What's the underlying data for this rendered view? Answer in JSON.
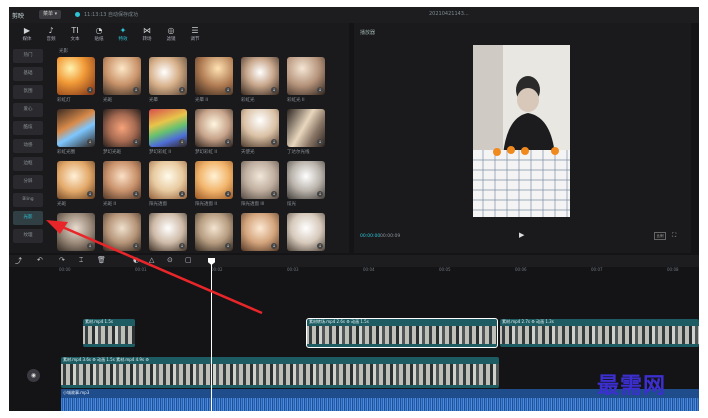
{
  "titlebar": {
    "app_name": "剪映",
    "menu": "菜单 ▾",
    "status": "11:13:13 自动保存成功",
    "project": "20210421143..."
  },
  "tabs": [
    {
      "icon": "▶",
      "label": "媒体"
    },
    {
      "icon": "♪",
      "label": "音频"
    },
    {
      "icon": "TI",
      "label": "文本"
    },
    {
      "icon": "◔",
      "label": "贴纸"
    },
    {
      "icon": "✦",
      "label": "特效"
    },
    {
      "icon": "⋈",
      "label": "转场"
    },
    {
      "icon": "◎",
      "label": "滤镜"
    },
    {
      "icon": "☰",
      "label": "调节"
    }
  ],
  "categories": [
    "热门",
    "基础",
    "氛围",
    "爱心",
    "酷炫",
    "动感",
    "边框",
    "分屏",
    "Bling",
    "光影",
    "纹理"
  ],
  "active_category": "光影",
  "grid_heading": "光影",
  "effects": [
    {
      "label": "彩虹灯",
      "g": "radial-gradient(circle at 35% 30%,#fff3b0,#f29b38 40%,#8a3d1a 90%)"
    },
    {
      "label": "光斑",
      "g": "radial-gradient(circle at 50% 30%,#fde7c7,#c9936a 50%,#4a3a2e 95%)"
    },
    {
      "label": "光晕",
      "g": "radial-gradient(circle at 40% 40%,#fff,#d7b08a 45%,#5d4838 95%)"
    },
    {
      "label": "光晕 II",
      "g": "radial-gradient(circle at 60% 30%,#ffe2b3,#b07b52 50%,#3a2a20 95%)"
    },
    {
      "label": "彩虹光",
      "g": "radial-gradient(circle at 50% 40%,#fff,#c9a88d 45%,#433126 95%)"
    },
    {
      "label": "彩虹光 II",
      "g": "radial-gradient(circle at 40% 30%,#f5e6d4,#b4927a 50%,#3b2d24 95%)"
    },
    {
      "label": "彩虹光圈",
      "g": "linear-gradient(150deg,#3b2a22,#d98b4a 40%,#7dc7ff 60%,#2b1f19)"
    },
    {
      "label": "梦幻光斑",
      "g": "radial-gradient(circle at 50% 50%,#f6a27a,#a76b52 50%,#2f2420 95%)"
    },
    {
      "label": "梦幻彩虹 II",
      "g": "linear-gradient(160deg,#d64d4d,#e8c54a 35%,#66c16f 55%,#4f6fd8 75%,#2e2220)"
    },
    {
      "label": "梦幻彩虹 II",
      "g": "radial-gradient(circle at 50% 40%,#fff6e0,#c7a38a 50%,#3b2d26 95%)"
    },
    {
      "label": "天使光",
      "g": "radial-gradient(circle at 50% 30%,#fff,#d9c0a4 50%,#5a4637 95%)"
    },
    {
      "label": "丁达尔光线",
      "g": "linear-gradient(120deg,#2c2420,#e9d7be 45%,#8a7666 70%,#2c2420)"
    },
    {
      "label": "光斑",
      "g": "radial-gradient(circle at 45% 40%,#fff0d8,#e2a869 50%,#6d4424 95%)"
    },
    {
      "label": "光斑 II",
      "g": "radial-gradient(circle at 50% 40%,#fbe0c6,#c9926c 50%,#5b3e2c 95%)"
    },
    {
      "label": "阳光透窗",
      "g": "radial-gradient(circle at 50% 40%,#fffbea,#e8caa0 50%,#9b6a44 95%)"
    },
    {
      "label": "阳光透窗 II",
      "g": "radial-gradient(circle at 50% 40%,#fff2d6,#f2b56c 50%,#a35f2b 95%)"
    },
    {
      "label": "阳光透窗 III",
      "g": "radial-gradient(circle at 50% 40%,#f1e7da,#bfae9f 50%,#5e5249 95%)"
    },
    {
      "label": "炫光",
      "g": "radial-gradient(circle at 50% 40%,#fff,#b9b3ab 50%,#4d4843 95%)"
    },
    {
      "label": "",
      "g": "radial-gradient(circle at 50% 40%,#e8dccf,#9c8b7b 50%,#3d342c 95%)"
    },
    {
      "label": "",
      "g": "radial-gradient(circle at 50% 40%,#efe0cd,#b59478 50%,#3e3026 95%)"
    },
    {
      "label": "",
      "g": "radial-gradient(circle at 50% 40%,#fff,#cfbba8 50%,#4b3d31 95%)"
    },
    {
      "label": "",
      "g": "radial-gradient(circle at 50% 40%,#f4e4d0,#b69c80 50%,#3e3228 95%)"
    },
    {
      "label": "",
      "g": "radial-gradient(circle at 50% 40%,#fde9d4,#d3a47c 50%,#5f412d 95%)"
    },
    {
      "label": "",
      "g": "radial-gradient(circle at 50% 40%,#fff,#d6c9bb 50%,#5a4e44 95%)"
    }
  ],
  "player": {
    "title": "播放器",
    "time_current": "00:00:00",
    "time_total": "00:00:09",
    "play_icon": "▶",
    "ratio_label": "比例",
    "fullscreen_icon": "⛶"
  },
  "toolbar": {
    "tools": [
      "⤴",
      "↶",
      "↷",
      "⌶",
      "🗑",
      "◐",
      "△",
      "⊙",
      "▢"
    ]
  },
  "ruler": [
    "00:00",
    "00:01",
    "00:02",
    "00:03",
    "00:04",
    "00:05",
    "00:06",
    "00:07",
    "00:08"
  ],
  "clips": {
    "top_small": {
      "label": "素材.mp4  1.5s"
    },
    "top_selected": {
      "label": "素材转场.mp4  2.6s  ⚙ 动画  1.5s"
    },
    "top_right": {
      "label": "素材.mp4  2.7s  ⚙ 动画  1.3s"
    },
    "main": {
      "label": "素材.mp4  3.6s  ⚙ 动画  1.5s  素材.mp4  4.9s  ⚙"
    }
  },
  "audio": {
    "label": "小城故事.mp3"
  },
  "watermark": "最需网",
  "accent_color": "#2ec4d6"
}
